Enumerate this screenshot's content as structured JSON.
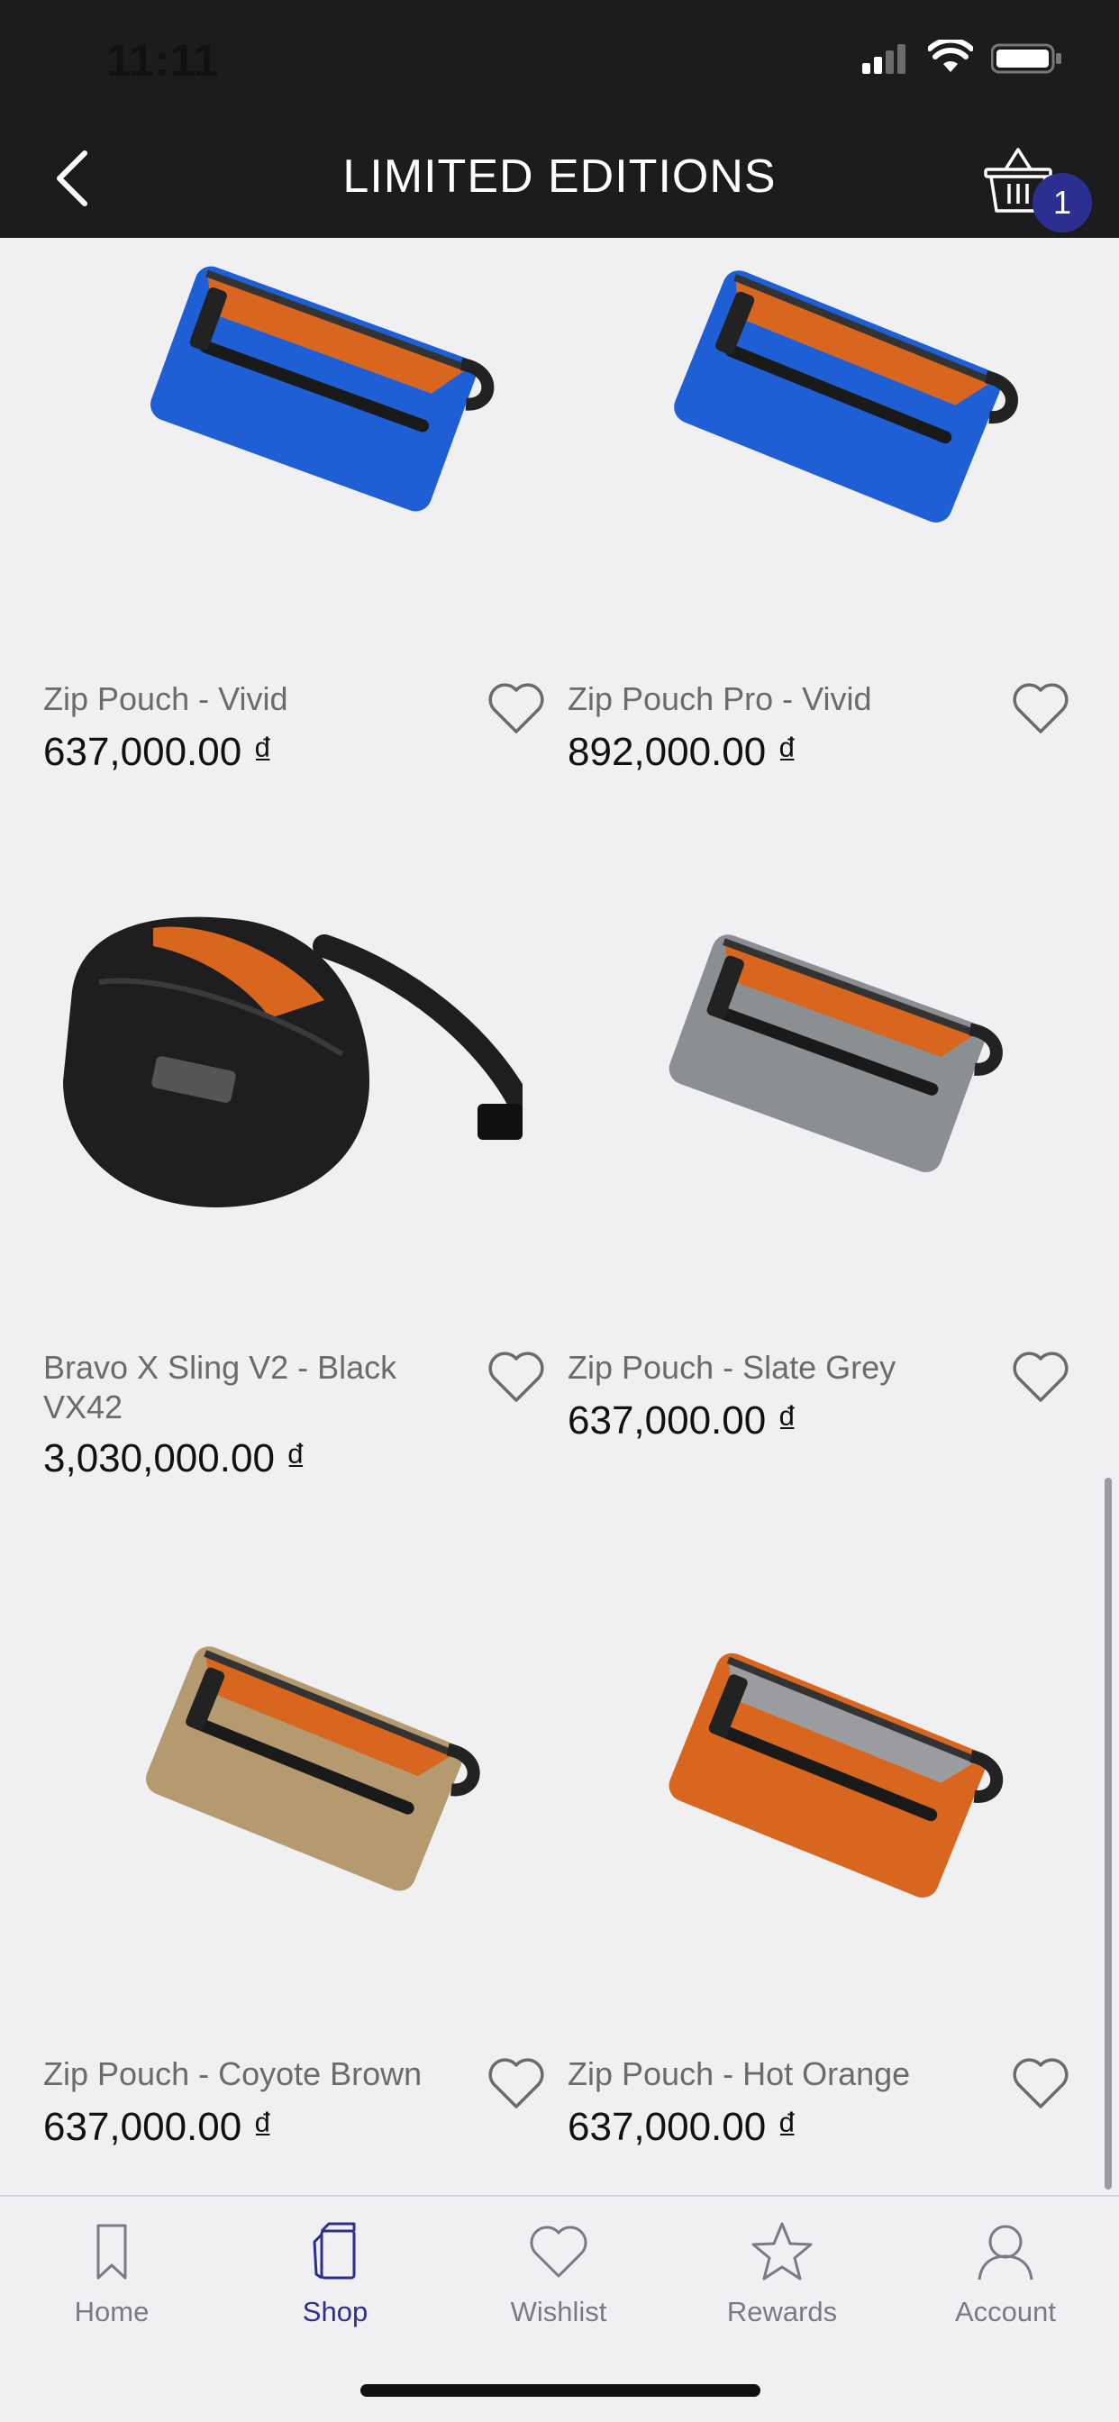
{
  "status_bar": {
    "time": "11:11"
  },
  "header": {
    "title": "LIMITED EDITIONS",
    "cart_count": "1"
  },
  "products": [
    {
      "name": "Zip Pouch - Vivid",
      "price": "637,000.00 ₫",
      "color": "#1f5fd6"
    },
    {
      "name": "Zip Pouch Pro - Vivid",
      "price": "892,000.00 ₫",
      "color": "#1f5fd6"
    },
    {
      "name": "Bravo X Sling V2 - Black VX42",
      "price": "3,030,000.00 ₫",
      "color": "#1e1e20"
    },
    {
      "name": "Zip Pouch - Slate Grey",
      "price": "637,000.00 ₫",
      "color": "#8c8f92"
    },
    {
      "name": "Zip Pouch - Coyote Brown",
      "price": "637,000.00 ₫",
      "color": "#b59a70"
    },
    {
      "name": "Zip Pouch - Hot Orange",
      "price": "637,000.00 ₫",
      "color": "#d9661e"
    }
  ],
  "tabs": [
    {
      "label": "Home",
      "icon": "bookmark-icon"
    },
    {
      "label": "Shop",
      "icon": "shop-icon"
    },
    {
      "label": "Wishlist",
      "icon": "heart-icon"
    },
    {
      "label": "Rewards",
      "icon": "star-icon"
    },
    {
      "label": "Account",
      "icon": "person-icon"
    }
  ],
  "colors": {
    "accent": "#2b2f8f",
    "header_bg": "#1c1c1e",
    "page_bg": "#f0eff1",
    "lining": "#d9661e"
  }
}
